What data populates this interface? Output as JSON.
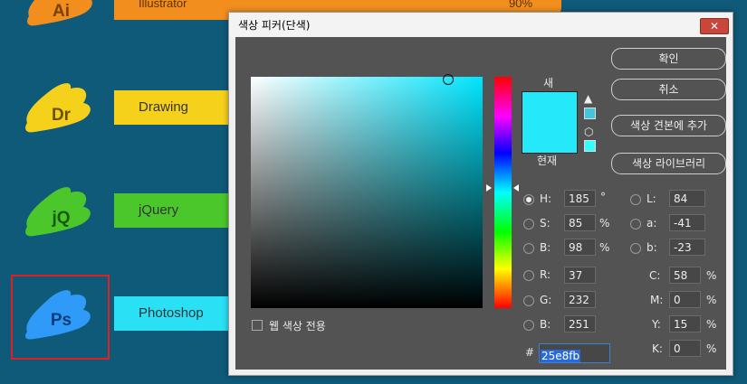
{
  "skills": [
    {
      "abbr": "Ai",
      "name": "Illustrator",
      "percent": "90%",
      "color": "#f28e1e",
      "abbr_color": "#7a3f00"
    },
    {
      "abbr": "Dr",
      "name": "Drawing",
      "color": "#f5d11c",
      "abbr_color": "#6b5200"
    },
    {
      "abbr": "jQ",
      "name": "jQuery",
      "color": "#4bc72c",
      "abbr_color": "#175a0a"
    },
    {
      "abbr": "Ps",
      "name": "Photoshop",
      "color": "#2f9af7",
      "abbr_color": "#0a3c7a",
      "bar_color": "#2ae0f5"
    }
  ],
  "dialog": {
    "title": "색상 피커(단색)",
    "close_symbol": "✕",
    "new_label": "새",
    "current_label": "현재",
    "new_color": "#25e8fb",
    "current_color": "#25e8fb",
    "warn_symbol": "▲",
    "cube_symbol": "⬡",
    "buttons": {
      "ok": "확인",
      "cancel": "취소",
      "add_to_swatches": "색상 견본에 추가",
      "color_libraries": "색상 라이브러리"
    },
    "hsb": {
      "h_label": "H:",
      "h_value": "185",
      "h_unit": "°",
      "s_label": "S:",
      "s_value": "85",
      "s_unit": "%",
      "b_label": "B:",
      "b_value": "98",
      "b_unit": "%"
    },
    "lab": {
      "l_label": "L:",
      "l_value": "84",
      "a_label": "a:",
      "a_value": "-41",
      "b_label": "b:",
      "b_value": "-23"
    },
    "rgb": {
      "r_label": "R:",
      "r_value": "37",
      "g_label": "G:",
      "g_value": "232",
      "b_label": "B:",
      "b_value": "251"
    },
    "cmyk": {
      "c_label": "C:",
      "c_value": "58",
      "c_unit": "%",
      "m_label": "M:",
      "m_value": "0",
      "m_unit": "%",
      "y_label": "Y:",
      "y_value": "15",
      "y_unit": "%",
      "k_label": "K:",
      "k_value": "0",
      "k_unit": "%"
    },
    "hex_label": "#",
    "hex_value": "25e8fb",
    "web_colors_label": "웹 색상 전용",
    "hue_base_color": "#00e5ff"
  }
}
